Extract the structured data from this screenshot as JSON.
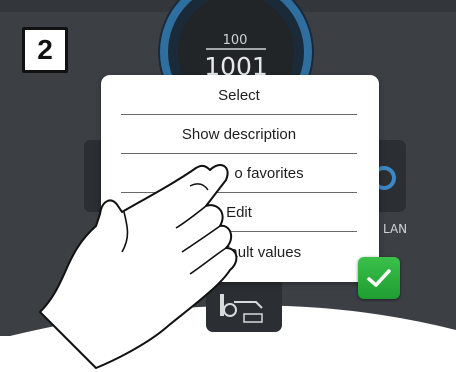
{
  "step_number": "2",
  "dial": {
    "upper_value": "100",
    "main_value": "1001"
  },
  "background_labels": {
    "lan": "LAN"
  },
  "context_menu": {
    "items": [
      {
        "label": "Select"
      },
      {
        "label": "Show description"
      },
      {
        "label": "o favorites"
      },
      {
        "label": "Edit"
      },
      {
        "label": "efault values"
      }
    ]
  },
  "confirm_button": {
    "icon": "checkmark-icon",
    "color": "#2bb13c"
  },
  "colors": {
    "panel_dark": "#3a3e43",
    "dial_ring": "#2f6fa0",
    "menu_bg": "#ffffff",
    "accent_green": "#2bb13c"
  }
}
